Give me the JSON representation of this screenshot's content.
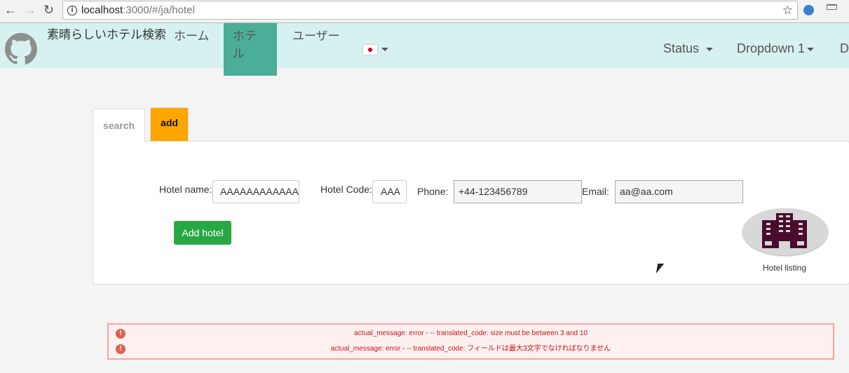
{
  "browser": {
    "url_host": "localhost",
    "url_rest": ":3000/#/ja/hotel"
  },
  "navbar": {
    "brand": "素晴らしいホテル検索",
    "items": [
      {
        "label": "ホーム"
      },
      {
        "label": "ホテル"
      },
      {
        "label": "ユーザー"
      }
    ],
    "right": [
      {
        "label": "Status"
      },
      {
        "label": "Dropdown 1"
      },
      {
        "label": "D"
      }
    ],
    "language": "ja"
  },
  "tabs": [
    {
      "label": "search"
    },
    {
      "label": "add"
    }
  ],
  "form": {
    "hotel_name_label": "Hotel name:",
    "hotel_name_value": "AAAAAAAAAAAA",
    "hotel_code_label": "Hotel Code:",
    "hotel_code_value": "AAA",
    "phone_label": "Phone:",
    "phone_value": "+44-123456789",
    "email_label": "Email:",
    "email_value": "aa@aa.com",
    "submit_label": "Add hotel"
  },
  "hotel_listing_label": "Hotel listing",
  "errors": [
    "actual_message: error - -- translated_code: size must be between 3 and 10",
    "actual_message: error - -- translated_code: フィールドは最大3文字でなければなりません"
  ],
  "colors": {
    "navbar": "#d6f1ef",
    "active_nav": "#4aae98",
    "add_tab": "#ffa500",
    "submit": "#28a745",
    "error_text": "#c2141a",
    "hotel_icon": "#4a0c2e"
  }
}
